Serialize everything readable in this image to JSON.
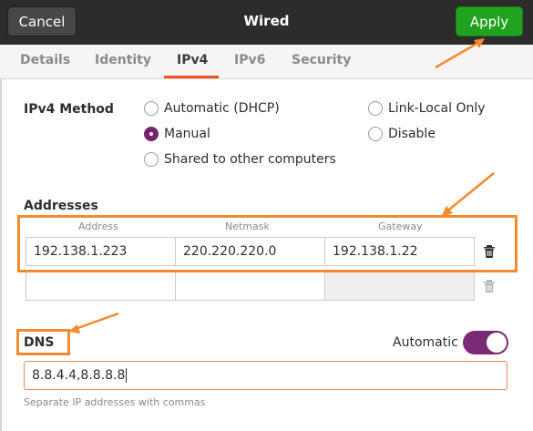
{
  "header": {
    "cancel_label": "Cancel",
    "title": "Wired",
    "apply_label": "Apply"
  },
  "tabs": [
    {
      "label": "Details",
      "active": false
    },
    {
      "label": "Identity",
      "active": false
    },
    {
      "label": "IPv4",
      "active": true
    },
    {
      "label": "IPv6",
      "active": false
    },
    {
      "label": "Security",
      "active": false
    }
  ],
  "ipv4_method": {
    "label": "IPv4 Method",
    "options": [
      {
        "label": "Automatic (DHCP)",
        "checked": false
      },
      {
        "label": "Manual",
        "checked": true
      },
      {
        "label": "Shared to other computers",
        "checked": false
      },
      {
        "label": "Link-Local Only",
        "checked": false
      },
      {
        "label": "Disable",
        "checked": false
      }
    ]
  },
  "addresses": {
    "label": "Addresses",
    "columns": [
      "Address",
      "Netmask",
      "Gateway"
    ],
    "rows": [
      {
        "address": "192.138.1.223",
        "netmask": "220.220.220.0",
        "gateway": "192.138.1.22"
      },
      {
        "address": "",
        "netmask": "",
        "gateway": ""
      }
    ]
  },
  "dns": {
    "label": "DNS",
    "automatic_label": "Automatic",
    "automatic_on": true,
    "value": "8.8.4.4,8.8.8.8",
    "hint": "Separate IP addresses with commas"
  },
  "colors": {
    "accent": "#e95420",
    "apply_green": "#21a21e",
    "toggle_purple": "#7a2a75",
    "annotation_orange": "#f28a2e"
  },
  "icons": [
    "trash-icon",
    "arrow-annotation"
  ]
}
